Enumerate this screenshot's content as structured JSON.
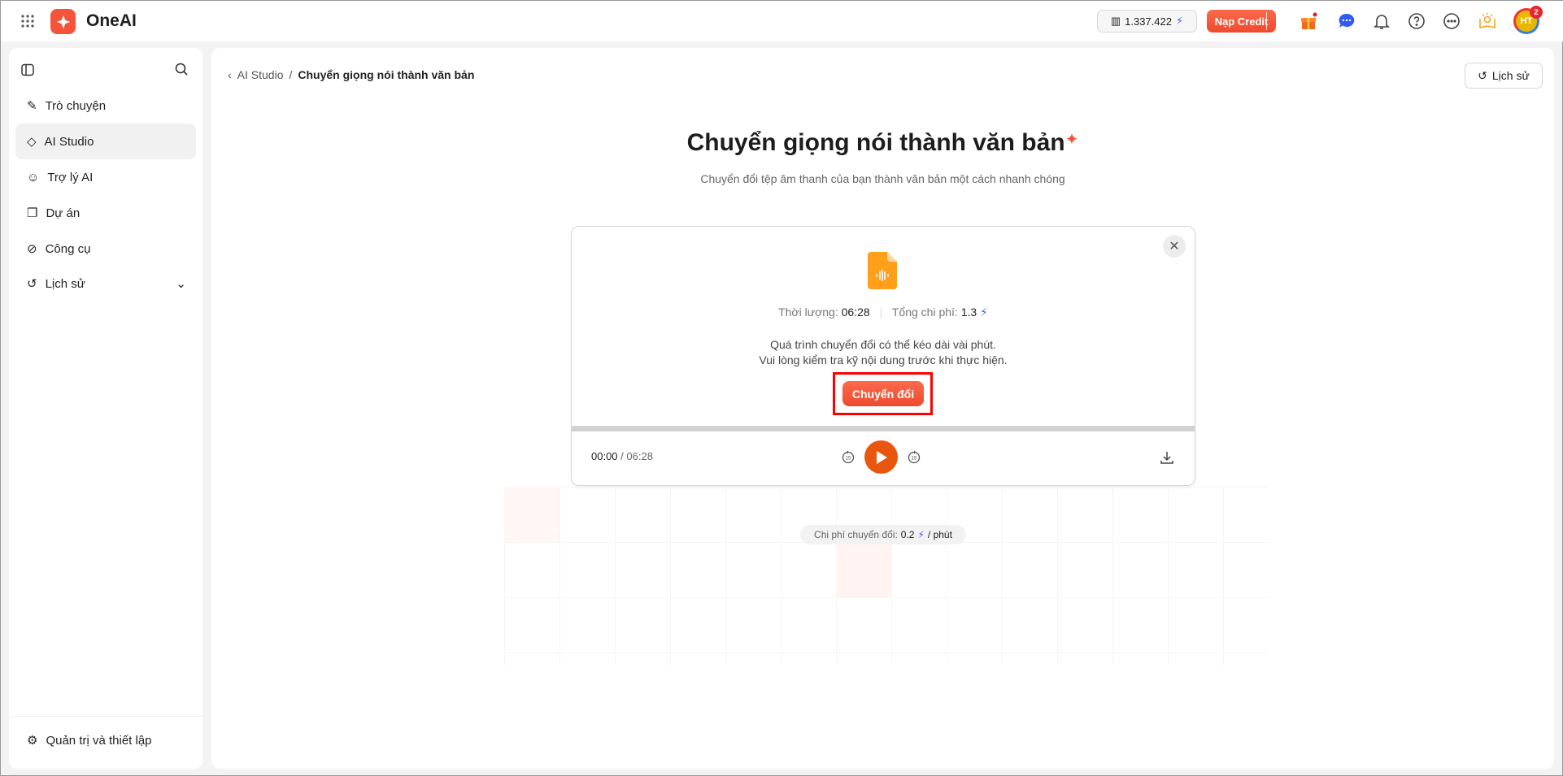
{
  "header": {
    "app_name": "OneAI",
    "credit_balance": "1.337.422",
    "topup_label": "Nạp Credit",
    "avatar_initials": "HT",
    "notification_count": "2"
  },
  "sidebar": {
    "items": [
      {
        "label": "Trò chuyện"
      },
      {
        "label": "AI Studio"
      },
      {
        "label": "Trợ lý AI"
      },
      {
        "label": "Dự án"
      },
      {
        "label": "Công cụ"
      },
      {
        "label": "Lịch sử"
      }
    ],
    "settings_label": "Quản trị và thiết lập"
  },
  "breadcrumb": {
    "parent": "AI Studio",
    "separator": "/",
    "current": "Chuyển giọng nói thành văn bản"
  },
  "history_button": "Lịch sử",
  "page": {
    "title": "Chuyển giọng nói thành văn bản",
    "subtitle": "Chuyển đổi tệp âm thanh của bạn thành văn bản một cách nhanh chóng"
  },
  "card": {
    "duration_label": "Thời lượng:",
    "duration": "06:28",
    "cost_label": "Tổng chi phí:",
    "cost": "1.3",
    "notice_line1": "Quá trình chuyển đổi có thể kéo dài vài phút.",
    "notice_line2": "Vui lòng kiểm tra kỹ nội dung trước khi thực hiện.",
    "convert_label": "Chuyển đổi",
    "current_time": "00:00",
    "total_time": "/ 06:28",
    "skip_seconds": "15",
    "progress": 0
  },
  "cost_info": {
    "label": "Chi phí chuyển đổi:",
    "value": "0.2",
    "unit": "/ phút"
  },
  "colors": {
    "accent": "#f4553a",
    "bolt": "#4b5cf0",
    "play": "#e8560f",
    "file": "#ff9f1a"
  }
}
